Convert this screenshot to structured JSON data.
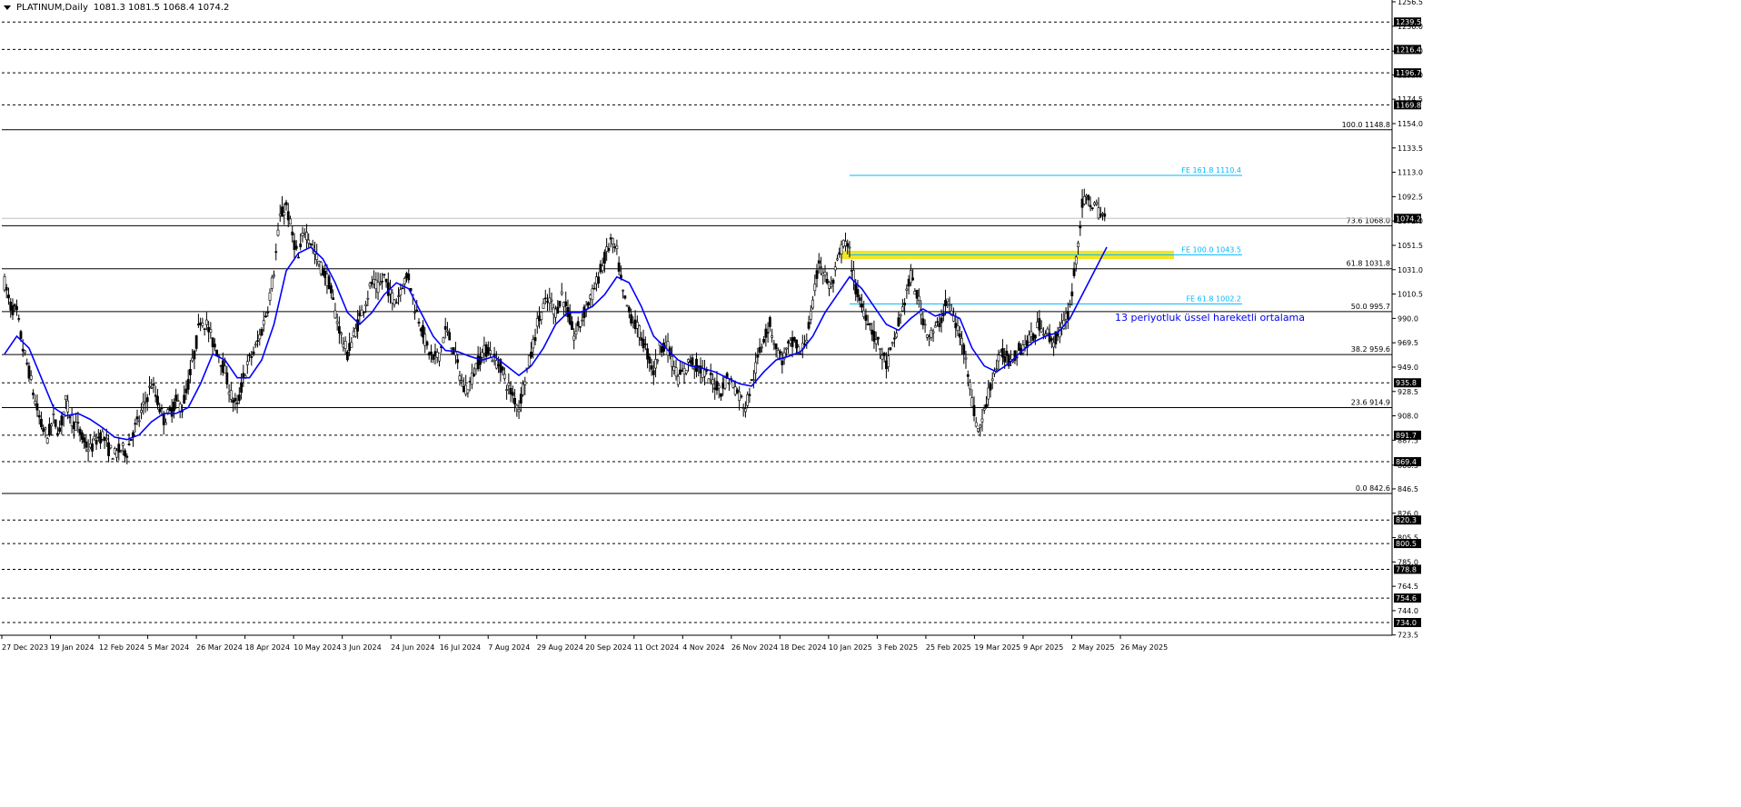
{
  "header": {
    "symbol": "PLATINUM,Daily",
    "ohlc": "1081.3 1081.5 1068.4 1074.2"
  },
  "colors": {
    "background": "#ffffff",
    "candles": "#000000",
    "ema": "#0000ff",
    "fib_retracement": "#000000",
    "fib_expansion": "#00b7ff",
    "support_zone": "#f0e000",
    "price_label_bg": "#000000",
    "price_label_text": "#ffffff"
  },
  "annotation": {
    "text": "13 periyotluk üssel hareketli ortalama"
  },
  "chart_data": {
    "type": "candlestick",
    "symbol": "PLATINUM",
    "timeframe": "Daily",
    "last_price": 1074.2,
    "ylim": [
      723.3,
      1256.5
    ],
    "y_ticks": [
      1256.5,
      1236.0,
      1215.0,
      1195.0,
      1174.5,
      1154.0,
      1133.5,
      1113.0,
      1092.5,
      1072.0,
      1051.5,
      1031.0,
      1010.5,
      990.0,
      969.5,
      949.0,
      928.5,
      908.0,
      887.5,
      866.5,
      846.5,
      826.0,
      805.5,
      785.0,
      764.5,
      744.0,
      723.5
    ],
    "x_labels": [
      "27 Dec 2023",
      "19 Jan 2024",
      "12 Feb 2024",
      "5 Mar 2024",
      "26 Mar 2024",
      "18 Apr 2024",
      "10 May 2024",
      "3 Jun 2024",
      "24 Jun 2024",
      "16 Jul 2024",
      "7 Aug 2024",
      "29 Aug 2024",
      "20 Sep 2024",
      "11 Oct 2024",
      "4 Nov 2024",
      "26 Nov 2024",
      "18 Dec 2024",
      "10 Jan 2025",
      "3 Feb 2025",
      "25 Feb 2025",
      "19 Mar 2025",
      "9 Apr 2025",
      "2 May 2025",
      "26 May 2025"
    ],
    "horizontal_levels": [
      {
        "label": "1239.5",
        "value": 1239.5
      },
      {
        "label": "1216.4",
        "value": 1216.4
      },
      {
        "label": "1196.7",
        "value": 1196.7
      },
      {
        "label": "1169.8",
        "value": 1169.8
      },
      {
        "label": "935.8",
        "value": 935.8
      },
      {
        "label": "891.7",
        "value": 891.7
      },
      {
        "label": "869.4",
        "value": 869.4
      },
      {
        "label": "820.3",
        "value": 820.3
      },
      {
        "label": "800.5",
        "value": 800.5
      },
      {
        "label": "778.8",
        "value": 778.8
      },
      {
        "label": "754.6",
        "value": 754.6
      },
      {
        "label": "734.0",
        "value": 734.0
      }
    ],
    "fibo_retracement": [
      {
        "label": "100.0 1148.8",
        "value": 1148.8
      },
      {
        "label": "73.6 1068.0",
        "value": 1068.0
      },
      {
        "label": "61.8 1031.8",
        "value": 1031.8
      },
      {
        "label": "50.0 995.7",
        "value": 995.7
      },
      {
        "label": "38.2 959.6",
        "value": 959.6
      },
      {
        "label": "23.6 914.9",
        "value": 914.9
      },
      {
        "label": "0.0 842.6",
        "value": 842.6
      }
    ],
    "fibo_expansion": [
      {
        "label": "FE 161.8 1110.4",
        "value": 1110.4
      },
      {
        "label": "FE 100.0 1043.5",
        "value": 1043.5
      },
      {
        "label": "FE 61.8 1002.2",
        "value": 1002.2
      }
    ],
    "support_zone": {
      "low": 1040.0,
      "high": 1047.0
    },
    "last_price_label": "1074.2",
    "price_path": [
      [
        0,
        1020
      ],
      [
        3,
        1000
      ],
      [
        6,
        995
      ],
      [
        9,
        965
      ],
      [
        12,
        945
      ],
      [
        15,
        920
      ],
      [
        18,
        900
      ],
      [
        21,
        890
      ],
      [
        24,
        905
      ],
      [
        27,
        895
      ],
      [
        30,
        920
      ],
      [
        33,
        905
      ],
      [
        36,
        898
      ],
      [
        39,
        885
      ],
      [
        42,
        880
      ],
      [
        45,
        888
      ],
      [
        48,
        892
      ],
      [
        51,
        880
      ],
      [
        54,
        875
      ],
      [
        57,
        880
      ],
      [
        60,
        878
      ],
      [
        63,
        895
      ],
      [
        66,
        905
      ],
      [
        69,
        920
      ],
      [
        72,
        935
      ],
      [
        75,
        920
      ],
      [
        78,
        905
      ],
      [
        81,
        910
      ],
      [
        84,
        920
      ],
      [
        87,
        915
      ],
      [
        90,
        935
      ],
      [
        93,
        960
      ],
      [
        96,
        990
      ],
      [
        99,
        985
      ],
      [
        102,
        970
      ],
      [
        105,
        960
      ],
      [
        108,
        945
      ],
      [
        111,
        925
      ],
      [
        114,
        915
      ],
      [
        117,
        940
      ],
      [
        120,
        955
      ],
      [
        123,
        965
      ],
      [
        126,
        980
      ],
      [
        129,
        1000
      ],
      [
        132,
        1030
      ],
      [
        135,
        1075
      ],
      [
        138,
        1085
      ],
      [
        141,
        1060
      ],
      [
        144,
        1040
      ],
      [
        147,
        1065
      ],
      [
        150,
        1055
      ],
      [
        153,
        1040
      ],
      [
        156,
        1030
      ],
      [
        159,
        1020
      ],
      [
        162,
        995
      ],
      [
        165,
        975
      ],
      [
        168,
        960
      ],
      [
        171,
        975
      ],
      [
        174,
        990
      ],
      [
        177,
        1005
      ],
      [
        180,
        1020
      ],
      [
        183,
        1015
      ],
      [
        186,
        1025
      ],
      [
        189,
        1010
      ],
      [
        192,
        1005
      ],
      [
        195,
        1020
      ],
      [
        198,
        1025
      ],
      [
        201,
        1000
      ],
      [
        204,
        985
      ],
      [
        207,
        965
      ],
      [
        210,
        955
      ],
      [
        213,
        960
      ],
      [
        216,
        980
      ],
      [
        219,
        970
      ],
      [
        222,
        950
      ],
      [
        225,
        930
      ],
      [
        228,
        935
      ],
      [
        231,
        950
      ],
      [
        234,
        960
      ],
      [
        237,
        965
      ],
      [
        240,
        955
      ],
      [
        243,
        950
      ],
      [
        246,
        935
      ],
      [
        249,
        925
      ],
      [
        252,
        915
      ],
      [
        255,
        940
      ],
      [
        258,
        960
      ],
      [
        261,
        985
      ],
      [
        264,
        1000
      ],
      [
        267,
        1005
      ],
      [
        270,
        995
      ],
      [
        273,
        1010
      ],
      [
        276,
        995
      ],
      [
        279,
        975
      ],
      [
        282,
        985
      ],
      [
        285,
        1000
      ],
      [
        288,
        1010
      ],
      [
        291,
        1025
      ],
      [
        294,
        1040
      ],
      [
        297,
        1055
      ],
      [
        300,
        1045
      ],
      [
        303,
        1010
      ],
      [
        306,
        995
      ],
      [
        309,
        985
      ],
      [
        312,
        975
      ],
      [
        315,
        960
      ],
      [
        318,
        945
      ],
      [
        321,
        965
      ],
      [
        324,
        970
      ],
      [
        327,
        955
      ],
      [
        330,
        940
      ],
      [
        333,
        945
      ],
      [
        336,
        955
      ],
      [
        339,
        950
      ],
      [
        342,
        945
      ],
      [
        345,
        940
      ],
      [
        348,
        935
      ],
      [
        351,
        930
      ],
      [
        354,
        940
      ],
      [
        357,
        935
      ],
      [
        360,
        925
      ],
      [
        363,
        915
      ],
      [
        366,
        935
      ],
      [
        369,
        955
      ],
      [
        372,
        975
      ],
      [
        375,
        985
      ],
      [
        378,
        965
      ],
      [
        381,
        955
      ],
      [
        384,
        965
      ],
      [
        387,
        970
      ],
      [
        390,
        960
      ],
      [
        393,
        975
      ],
      [
        396,
        1000
      ],
      [
        399,
        1040
      ],
      [
        402,
        1025
      ],
      [
        405,
        1015
      ],
      [
        408,
        1035
      ],
      [
        411,
        1055
      ],
      [
        414,
        1045
      ],
      [
        417,
        1015
      ],
      [
        420,
        1000
      ],
      [
        423,
        990
      ],
      [
        426,
        975
      ],
      [
        429,
        965
      ],
      [
        432,
        950
      ],
      [
        435,
        965
      ],
      [
        438,
        985
      ],
      [
        441,
        1005
      ],
      [
        444,
        1025
      ],
      [
        447,
        1010
      ],
      [
        450,
        990
      ],
      [
        453,
        975
      ],
      [
        456,
        980
      ],
      [
        459,
        990
      ],
      [
        462,
        1005
      ],
      [
        465,
        990
      ],
      [
        468,
        975
      ],
      [
        471,
        960
      ],
      [
        474,
        920
      ],
      [
        477,
        895
      ],
      [
        480,
        910
      ],
      [
        483,
        935
      ],
      [
        486,
        950
      ],
      [
        489,
        960
      ],
      [
        492,
        955
      ],
      [
        495,
        960
      ],
      [
        498,
        965
      ],
      [
        501,
        970
      ],
      [
        504,
        975
      ],
      [
        507,
        985
      ],
      [
        510,
        980
      ],
      [
        513,
        970
      ],
      [
        516,
        975
      ],
      [
        519,
        985
      ],
      [
        522,
        1000
      ],
      [
        525,
        1040
      ],
      [
        528,
        1085
      ],
      [
        531,
        1090
      ],
      [
        534,
        1085
      ],
      [
        537,
        1078
      ],
      [
        540,
        1074
      ]
    ],
    "ema_13": [
      [
        0,
        960
      ],
      [
        6,
        975
      ],
      [
        12,
        965
      ],
      [
        18,
        940
      ],
      [
        24,
        915
      ],
      [
        30,
        908
      ],
      [
        36,
        910
      ],
      [
        42,
        905
      ],
      [
        48,
        898
      ],
      [
        54,
        890
      ],
      [
        60,
        888
      ],
      [
        66,
        892
      ],
      [
        72,
        903
      ],
      [
        78,
        910
      ],
      [
        84,
        910
      ],
      [
        90,
        915
      ],
      [
        96,
        935
      ],
      [
        102,
        960
      ],
      [
        108,
        955
      ],
      [
        114,
        940
      ],
      [
        120,
        940
      ],
      [
        126,
        955
      ],
      [
        132,
        985
      ],
      [
        138,
        1030
      ],
      [
        144,
        1045
      ],
      [
        150,
        1050
      ],
      [
        156,
        1040
      ],
      [
        162,
        1020
      ],
      [
        168,
        995
      ],
      [
        174,
        985
      ],
      [
        180,
        995
      ],
      [
        186,
        1010
      ],
      [
        192,
        1020
      ],
      [
        198,
        1015
      ],
      [
        204,
        995
      ],
      [
        210,
        975
      ],
      [
        216,
        963
      ],
      [
        222,
        962
      ],
      [
        228,
        958
      ],
      [
        234,
        955
      ],
      [
        240,
        958
      ],
      [
        246,
        950
      ],
      [
        252,
        942
      ],
      [
        258,
        950
      ],
      [
        264,
        965
      ],
      [
        270,
        985
      ],
      [
        276,
        995
      ],
      [
        282,
        995
      ],
      [
        288,
        1000
      ],
      [
        294,
        1010
      ],
      [
        300,
        1025
      ],
      [
        306,
        1020
      ],
      [
        312,
        1000
      ],
      [
        318,
        975
      ],
      [
        324,
        965
      ],
      [
        330,
        955
      ],
      [
        336,
        950
      ],
      [
        342,
        948
      ],
      [
        348,
        945
      ],
      [
        354,
        940
      ],
      [
        360,
        935
      ],
      [
        366,
        933
      ],
      [
        372,
        945
      ],
      [
        378,
        955
      ],
      [
        384,
        958
      ],
      [
        390,
        962
      ],
      [
        396,
        975
      ],
      [
        402,
        995
      ],
      [
        408,
        1010
      ],
      [
        414,
        1025
      ],
      [
        420,
        1015
      ],
      [
        426,
        1000
      ],
      [
        432,
        985
      ],
      [
        438,
        980
      ],
      [
        444,
        990
      ],
      [
        450,
        998
      ],
      [
        456,
        992
      ],
      [
        462,
        995
      ],
      [
        468,
        990
      ],
      [
        474,
        965
      ],
      [
        480,
        950
      ],
      [
        486,
        945
      ],
      [
        492,
        952
      ],
      [
        498,
        962
      ],
      [
        504,
        970
      ],
      [
        510,
        975
      ],
      [
        516,
        978
      ],
      [
        522,
        990
      ],
      [
        528,
        1010
      ],
      [
        534,
        1030
      ],
      [
        540,
        1050
      ]
    ]
  }
}
